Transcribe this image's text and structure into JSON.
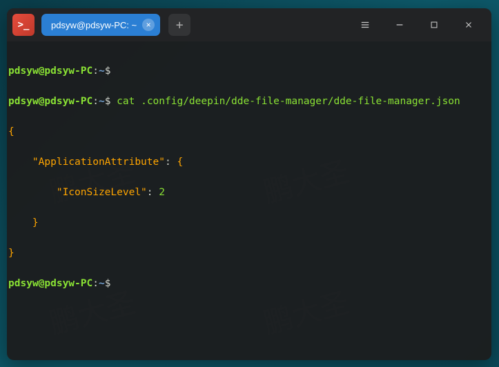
{
  "watermark": "鹏大圣",
  "titlebar": {
    "tab_title": "pdsyw@pdsyw-PC: ~",
    "tab_close": "×",
    "new_tab": "+"
  },
  "terminal": {
    "prompt": {
      "user_host": "pdsyw@pdsyw-PC",
      "sep1": ":",
      "cwd": "~",
      "sym": "$"
    },
    "line2": {
      "cmd": "cat",
      "arg": ".config/deepin/dde-file-manager/dde-file-manager.json"
    },
    "output": {
      "l1": "{",
      "l2_indent": "    ",
      "l2_key": "\"ApplicationAttribute\"",
      "l2_sep": ": ",
      "l2_brace": "{",
      "l3_indent": "        ",
      "l3_key": "\"IconSizeLevel\"",
      "l3_sep": ": ",
      "l3_val": "2",
      "l4_indent": "    ",
      "l4_brace": "}",
      "l5": "}"
    }
  }
}
